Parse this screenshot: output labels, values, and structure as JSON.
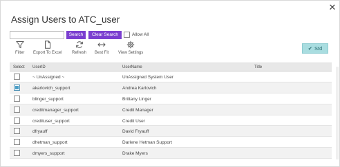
{
  "dialog": {
    "title": "Assign Users to ATC_user",
    "close_icon": "close-icon"
  },
  "search": {
    "value": "",
    "placeholder": "",
    "search_label": "Search",
    "clear_label": "Clear Search",
    "allow_all_label": "Allow All",
    "allow_all_checked": false
  },
  "toolbar": {
    "filter_label": "Filter",
    "export_label": "Export To Excel",
    "refresh_label": "Refresh",
    "bestfit_label": "Best Fit",
    "viewsettings_label": "View Settings",
    "std_label": "Std"
  },
  "colors": {
    "accent_purple": "#7b3fd0",
    "std_button": "#a9dde0"
  },
  "grid": {
    "columns": [
      "Select",
      "UserID",
      "UserName",
      "Title"
    ],
    "rows": [
      {
        "selected": false,
        "user_id": "~ UnAssigned ~",
        "user_name": "UnAssigned System User",
        "title": ""
      },
      {
        "selected": true,
        "user_id": "akarlovich_support",
        "user_name": "Andrea Karlovich",
        "title": ""
      },
      {
        "selected": false,
        "user_id": "blinger_support",
        "user_name": "Brittany Linger",
        "title": ""
      },
      {
        "selected": false,
        "user_id": "creditmanager_support",
        "user_name": "Credit Manager",
        "title": ""
      },
      {
        "selected": false,
        "user_id": "credituser_support",
        "user_name": "Credit User",
        "title": ""
      },
      {
        "selected": false,
        "user_id": "dfryauff",
        "user_name": "David Fryauff",
        "title": ""
      },
      {
        "selected": false,
        "user_id": "dhetman_support",
        "user_name": "Darlene Hetman Support",
        "title": ""
      },
      {
        "selected": false,
        "user_id": "dmyers_support",
        "user_name": "Drake Myers",
        "title": ""
      }
    ]
  }
}
